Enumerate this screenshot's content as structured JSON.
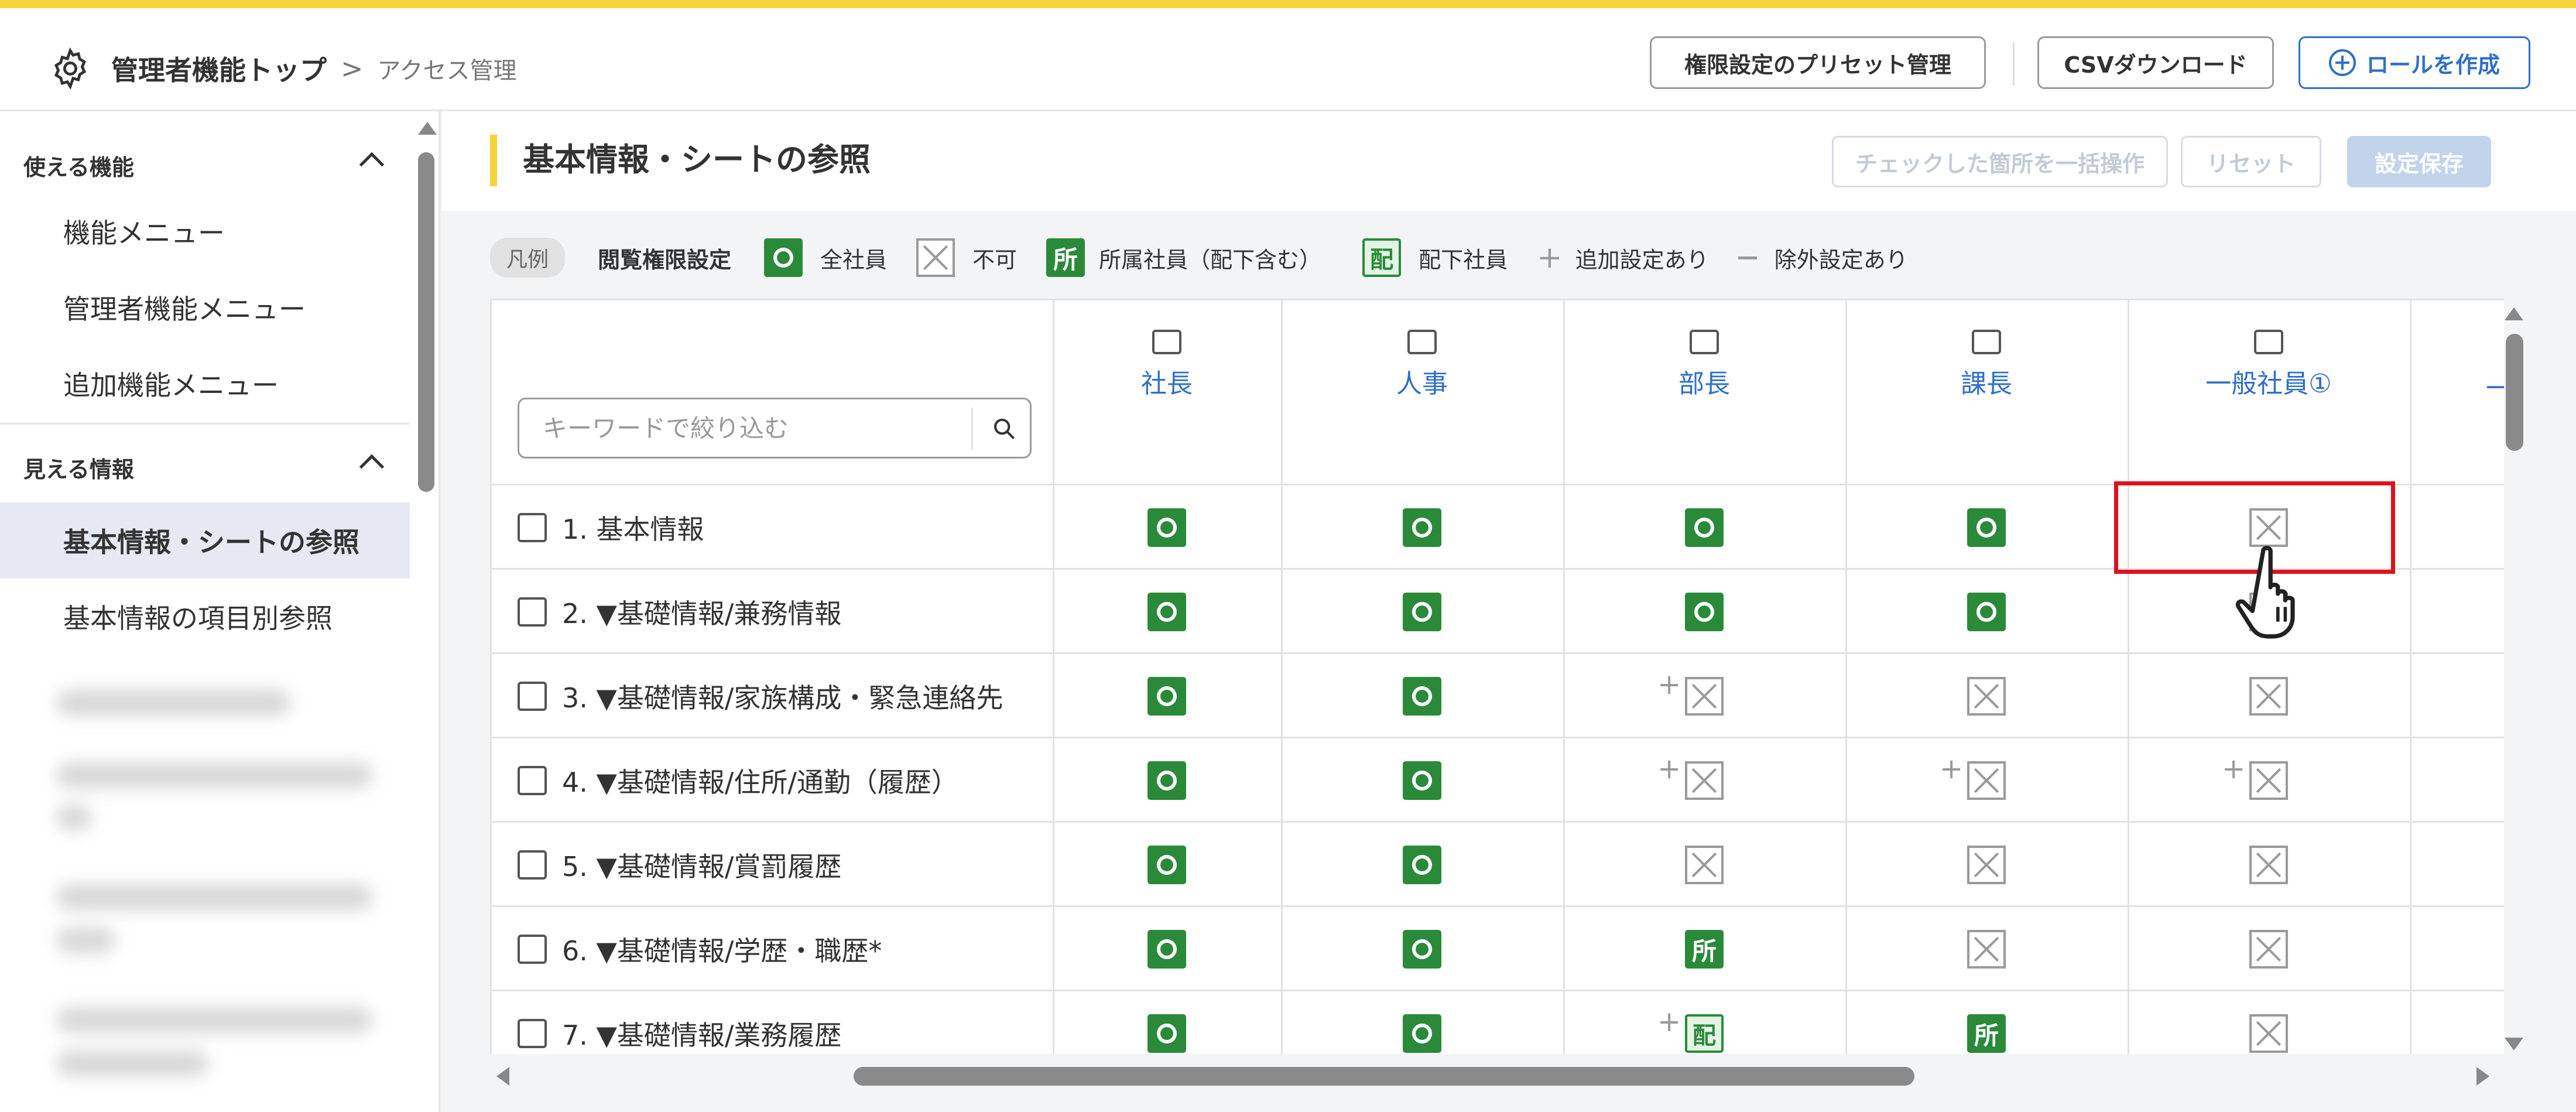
{
  "header": {
    "breadcrumb_root": "管理者機能トップ",
    "breadcrumb_sep": ">",
    "breadcrumb_current": "アクセス管理",
    "preset_button": "権限設定のプリセット管理",
    "csv_button": "CSVダウンロード",
    "create_role_button": "ロールを作成"
  },
  "sidebar": {
    "section1": "使える機能",
    "section1_items": [
      "機能メニュー",
      "管理者機能メニュー",
      "追加機能メニュー"
    ],
    "section2": "見える情報",
    "section2_items": [
      "基本情報・シートの参照",
      "基本情報の項目別参照"
    ]
  },
  "main": {
    "title": "基本情報・シートの参照",
    "bulk_button": "チェックした箇所を一括操作",
    "reset_button": "リセット",
    "save_button": "設定保存"
  },
  "legend": {
    "pill": "凡例",
    "title": "閲覧権限設定",
    "all": "全社員",
    "none": "不可",
    "sho_glyph": "所",
    "sho": "所属社員（配下含む）",
    "hai_glyph": "配",
    "hai": "配下社員",
    "plus_glyph": "+",
    "plus": "追加設定あり",
    "minus": "除外設定あり"
  },
  "table": {
    "search_placeholder": "キーワードで絞り込む",
    "columns": [
      "社長",
      "人事",
      "部長",
      "課長",
      "一般社員①",
      "一"
    ],
    "rows": [
      {
        "label": "1. 基本情報",
        "cells": [
          "all",
          "all",
          "all",
          "all",
          "none"
        ]
      },
      {
        "label": "2. ▼基礎情報/兼務情報",
        "cells": [
          "all",
          "all",
          "all",
          "all",
          "none"
        ]
      },
      {
        "label": "3. ▼基礎情報/家族構成・緊急連絡先",
        "cells": [
          "all",
          "all",
          "plus-none",
          "none",
          "none"
        ]
      },
      {
        "label": "4. ▼基礎情報/住所/通勤（履歴）",
        "cells": [
          "all",
          "all",
          "plus-none",
          "plus-none",
          "plus-none"
        ]
      },
      {
        "label": "5. ▼基礎情報/賞罰履歴",
        "cells": [
          "all",
          "all",
          "none",
          "none",
          "none"
        ]
      },
      {
        "label": "6. ▼基礎情報/学歴・職歴*",
        "cells": [
          "all",
          "all",
          "sho",
          "none",
          "none"
        ]
      },
      {
        "label": "7. ▼基礎情報/業務履歴",
        "cells": [
          "all",
          "all",
          "plus-hai",
          "sho",
          "none"
        ]
      }
    ]
  },
  "colors": {
    "accent_yellow": "#f5d33b",
    "green": "#2a8a3a",
    "blue": "#2f6fc8",
    "highlight_red": "#e0101e"
  }
}
